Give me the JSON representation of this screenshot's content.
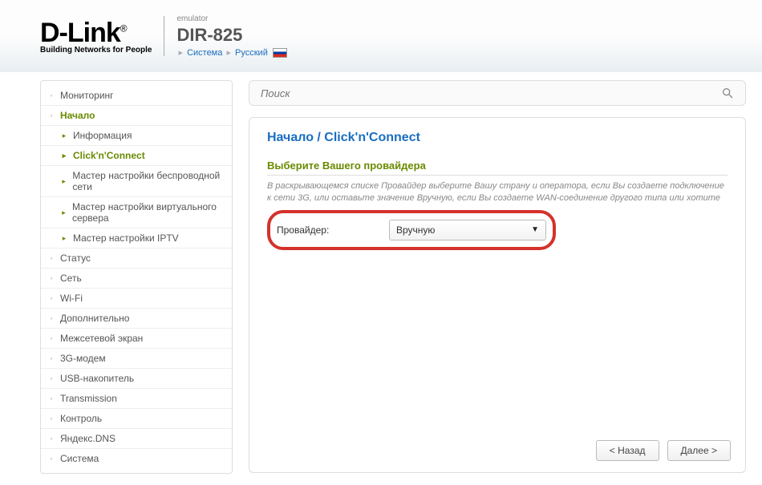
{
  "header": {
    "brand_main": "D-Link",
    "brand_sub": "Building Networks for People",
    "emulator": "emulator",
    "model": "DIR-825",
    "crumb1": "Система",
    "crumb2": "Русский"
  },
  "sidebar": {
    "items": [
      {
        "label": "Мониторинг",
        "level": 1
      },
      {
        "label": "Начало",
        "level": 1,
        "active_parent": true
      },
      {
        "label": "Информация",
        "level": 2
      },
      {
        "label": "Click'n'Connect",
        "level": 2,
        "active": true
      },
      {
        "label": "Мастер настройки беспроводной сети",
        "level": 2
      },
      {
        "label": "Мастер настройки виртуального сервера",
        "level": 2
      },
      {
        "label": "Мастер настройки IPTV",
        "level": 2
      },
      {
        "label": "Статус",
        "level": 1
      },
      {
        "label": "Сеть",
        "level": 1
      },
      {
        "label": "Wi-Fi",
        "level": 1
      },
      {
        "label": "Дополнительно",
        "level": 1
      },
      {
        "label": "Межсетевой экран",
        "level": 1
      },
      {
        "label": "3G-модем",
        "level": 1
      },
      {
        "label": "USB-накопитель",
        "level": 1
      },
      {
        "label": "Transmission",
        "level": 1
      },
      {
        "label": "Контроль",
        "level": 1
      },
      {
        "label": "Яндекс.DNS",
        "level": 1
      },
      {
        "label": "Система",
        "level": 1
      }
    ]
  },
  "search": {
    "placeholder": "Поиск"
  },
  "content": {
    "breadcrumb": "Начало /  Click'n'Connect",
    "section_title": "Выберите Вашего провайдера",
    "hint": "В раскрывающемся списке Провайдер выберите Вашу страну и оператора, если Вы создаете подключение к сети 3G, или оставьте значение Вручную, если Вы создаете WAN-соединение другого типа или хотите",
    "field_label": "Провайдер:",
    "select_value": "Вручную",
    "back_btn": "< Назад",
    "next_btn": "Далее >"
  }
}
